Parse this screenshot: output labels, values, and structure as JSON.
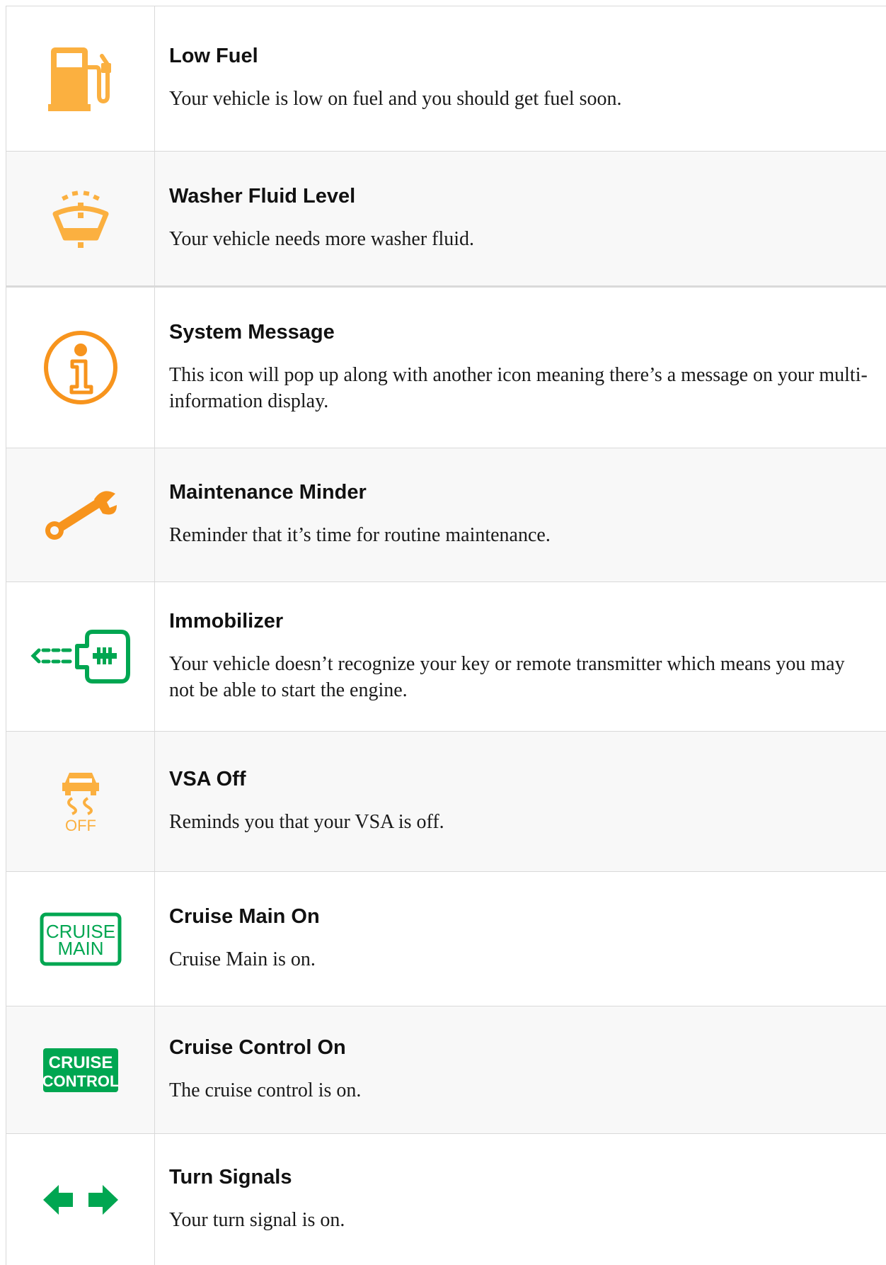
{
  "colors": {
    "amber": "#FBB040",
    "orange": "#F7941D",
    "green": "#00A651",
    "border": "#D9D9D9"
  },
  "rows": [
    {
      "icon": "fuel-pump-icon",
      "title": "Low Fuel",
      "description": "Your vehicle is low on fuel and you should get fuel soon."
    },
    {
      "icon": "washer-fluid-icon",
      "title": "Washer Fluid Level",
      "description": "Your vehicle needs more washer fluid."
    },
    {
      "icon": "info-icon",
      "title": "System Message",
      "description": "This icon will pop up along with another icon meaning there’s a message on your multi-information display."
    },
    {
      "icon": "wrench-icon",
      "title": "Maintenance Minder",
      "description": "Reminder that it’s time for routine maintenance."
    },
    {
      "icon": "immobilizer-key-icon",
      "title": "Immobilizer",
      "description": "Your vehicle doesn’t recognize your key or remote transmitter which means you may not be able to start the engine."
    },
    {
      "icon": "vsa-off-icon",
      "icon_text": "OFF",
      "title": "VSA Off",
      "description": "Reminds you that your VSA is off."
    },
    {
      "icon": "cruise-main-icon",
      "icon_text": [
        "CRUISE",
        "MAIN"
      ],
      "title": "Cruise Main On",
      "description": "Cruise Main is on."
    },
    {
      "icon": "cruise-control-icon",
      "icon_text": [
        "CRUISE",
        "CONTROL"
      ],
      "title": "Cruise Control On",
      "description": "The cruise control is on."
    },
    {
      "icon": "turn-signals-icon",
      "title": "Turn Signals",
      "description": "Your turn signal is on."
    }
  ]
}
